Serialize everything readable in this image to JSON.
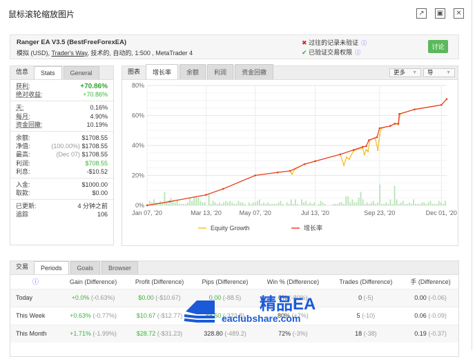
{
  "window": {
    "title": "鼠标滚轮缩放图片",
    "icons": [
      "external-link-icon",
      "maximize-icon",
      "close-icon"
    ]
  },
  "account": {
    "name": "Ranger EA V3.5 (BestFreeForexEA)",
    "desc_pre": "模拟 (USD), ",
    "broker": "Trader's Way",
    "desc_post": ", 技术的, 自动的, 1:500 , MetaTrader 4",
    "verify1": "过往的记录未验证",
    "verify2": "已验证交易权限",
    "discuss": "讨论"
  },
  "info": {
    "label": "信息",
    "tabs": [
      "Stats",
      "General"
    ],
    "groups": [
      [
        {
          "k": "获利:",
          "v": "+70.86%",
          "c": "gb"
        },
        {
          "k": "绝对收益:",
          "v": "+70.86%",
          "c": "g"
        }
      ],
      [
        {
          "k": "天:",
          "v": "0.16%"
        },
        {
          "k": "每月:",
          "v": "4.90%"
        },
        {
          "k": "资金回撤:",
          "v": "10.19%"
        }
      ],
      [
        {
          "k": "余额:",
          "v": "$1708.55"
        },
        {
          "k": "净值:",
          "pre": "(100.00%) ",
          "v": "$1708.55"
        },
        {
          "k": "最高:",
          "pre": "(Dec 07) ",
          "v": "$1708.55"
        },
        {
          "k": "利润:",
          "v": "$708.55",
          "c": "g"
        },
        {
          "k": "利息:",
          "v": "-$10.52"
        }
      ],
      [
        {
          "k": "入金:",
          "v": "$1000.00"
        },
        {
          "k": "取款:",
          "v": "$0.00"
        }
      ],
      [
        {
          "k": "已更新:",
          "v": "4 分钟之前"
        },
        {
          "k": "追踪",
          "v": "106"
        }
      ]
    ]
  },
  "chart_panel": {
    "label": "图表",
    "tabs": [
      "增长率",
      "余额",
      "利润",
      "资金回撤"
    ],
    "more": "更多",
    "export": "导"
  },
  "chart_data": {
    "type": "line",
    "ylim": [
      0,
      80
    ],
    "yticks": [
      "0%",
      "20%",
      "40%",
      "60%",
      "80%"
    ],
    "xticks": [
      "Jan 07, '20",
      "Mar 13, '20",
      "May 07, '20",
      "Jul 13, '20",
      "Sep 23, '20",
      "Dec 01, '20"
    ],
    "xrange": [
      "2020-01-07",
      "2020-12-07"
    ],
    "grid": true,
    "legend_placement": "bottom",
    "series": [
      {
        "name": "Equity Growth",
        "color": "#f5c02a",
        "points": [
          [
            "2020-01-07",
            0
          ],
          [
            "2020-02-01",
            2.5
          ],
          [
            "2020-03-13",
            7
          ],
          [
            "2020-04-01",
            11
          ],
          [
            "2020-05-07",
            20
          ],
          [
            "2020-06-01",
            22
          ],
          [
            "2020-06-15",
            23
          ],
          [
            "2020-06-17",
            21
          ],
          [
            "2020-06-20",
            24
          ],
          [
            "2020-07-01",
            27.5
          ],
          [
            "2020-07-13",
            29.5
          ],
          [
            "2020-08-10",
            34
          ],
          [
            "2020-08-14",
            27
          ],
          [
            "2020-08-17",
            32
          ],
          [
            "2020-08-20",
            31
          ],
          [
            "2020-08-25",
            36.5
          ],
          [
            "2020-09-04",
            38.5
          ],
          [
            "2020-09-06",
            34
          ],
          [
            "2020-09-08",
            37
          ],
          [
            "2020-09-10",
            36
          ],
          [
            "2020-09-12",
            43.5
          ],
          [
            "2020-09-18",
            45
          ],
          [
            "2020-09-21",
            37
          ],
          [
            "2020-09-23",
            47
          ],
          [
            "2020-09-25",
            51.5
          ],
          [
            "2020-10-05",
            53
          ],
          [
            "2020-10-10",
            54.5
          ],
          [
            "2020-10-14",
            54
          ],
          [
            "2020-10-16",
            61
          ],
          [
            "2020-11-01",
            64
          ],
          [
            "2020-12-01",
            67
          ],
          [
            "2020-12-07",
            70.9
          ]
        ]
      },
      {
        "name": "增长率",
        "color": "#e8412c",
        "points": [
          [
            "2020-01-07",
            0
          ],
          [
            "2020-02-01",
            2.5
          ],
          [
            "2020-03-13",
            7
          ],
          [
            "2020-04-01",
            11
          ],
          [
            "2020-05-07",
            20
          ],
          [
            "2020-06-01",
            22
          ],
          [
            "2020-06-15",
            23
          ],
          [
            "2020-07-01",
            27.5
          ],
          [
            "2020-07-13",
            29.5
          ],
          [
            "2020-08-10",
            34
          ],
          [
            "2020-08-25",
            37
          ],
          [
            "2020-09-04",
            39
          ],
          [
            "2020-09-08",
            39.5
          ],
          [
            "2020-09-11",
            43.5
          ],
          [
            "2020-09-20",
            45.5
          ],
          [
            "2020-09-23",
            51.5
          ],
          [
            "2020-10-05",
            53
          ],
          [
            "2020-10-10",
            54.5
          ],
          [
            "2020-10-14",
            54.5
          ],
          [
            "2020-10-15",
            61
          ],
          [
            "2020-11-01",
            64
          ],
          [
            "2020-12-01",
            67
          ],
          [
            "2020-12-07",
            70.9
          ]
        ]
      }
    ],
    "bars": {
      "color": "#b9e3b9",
      "values": [
        1,
        3,
        2,
        4,
        2,
        1,
        3,
        2,
        9,
        2,
        1,
        5,
        3,
        2,
        4,
        1,
        1,
        1,
        1,
        2,
        5,
        3,
        6,
        6,
        5,
        3,
        2,
        2,
        0,
        8,
        1,
        3,
        2,
        1,
        2,
        1,
        2,
        3,
        2,
        3,
        2,
        1,
        1,
        3,
        2,
        2,
        1,
        0,
        2,
        1,
        2,
        2,
        3,
        4,
        1,
        2,
        1,
        2,
        1,
        1,
        1,
        1,
        2,
        3,
        1,
        0,
        2,
        1,
        4,
        1,
        4,
        1,
        0,
        4,
        2,
        3,
        1,
        2,
        1,
        2,
        0,
        1,
        3,
        2,
        1,
        0,
        0,
        0,
        1,
        1,
        1,
        2,
        2,
        1,
        6,
        6,
        2,
        4,
        2,
        2,
        5,
        9,
        4,
        1,
        2,
        1,
        2,
        3,
        1,
        2,
        14,
        1,
        1,
        2,
        1,
        4,
        1,
        13,
        4,
        1,
        2,
        3,
        1,
        1,
        2,
        1,
        4,
        1,
        1,
        1,
        2,
        2,
        1,
        2,
        3,
        1,
        1,
        1,
        3,
        2,
        1,
        3
      ]
    }
  },
  "periods": {
    "label": "交易",
    "tabs": [
      "Periods",
      "Goals",
      "Browser"
    ],
    "headers": [
      "Gain (Difference)",
      "Profit (Difference)",
      "Pips (Difference)",
      "Win % (Difference)",
      "Trades (Difference)",
      "手 (Difference)"
    ],
    "rows": [
      {
        "name": "Today",
        "cells": [
          [
            "+0.0%",
            "(-0.63%)"
          ],
          [
            "$0.00",
            "(-$10.67)"
          ],
          [
            "0.00",
            "(-88.5)"
          ],
          [
            "0%",
            "(-80%)"
          ],
          [
            "0",
            "(-5)"
          ],
          [
            "0.00",
            "(-0.06)"
          ]
        ]
      },
      {
        "name": "This Week",
        "cells": [
          [
            "+0.63%",
            "(-0.77%)"
          ],
          [
            "$10.67",
            "(-$12.77)"
          ],
          [
            "88.50",
            "(-323.8)"
          ],
          [
            "80%",
            "(+7%)"
          ],
          [
            "5",
            "(-10)"
          ],
          [
            "0.06",
            "(-0.09)"
          ]
        ]
      },
      {
        "name": "This Month",
        "cells": [
          [
            "+1.71%",
            "(-1.99%)"
          ],
          [
            "$28.72",
            "(-$31.23)"
          ],
          [
            "328.80",
            "(-489.2)"
          ],
          [
            "72%",
            "(-3%)"
          ],
          [
            "18",
            "(-38)"
          ],
          [
            "0.19",
            "(-0.37)"
          ]
        ]
      }
    ],
    "green_cols": [
      [
        0,
        1,
        1,
        1
      ],
      [
        0,
        1,
        1,
        1
      ],
      [
        0,
        1,
        1,
        0
      ],
      [
        0,
        0,
        0,
        0
      ],
      [
        0,
        0,
        0,
        0
      ],
      [
        0,
        0,
        0,
        0
      ]
    ]
  },
  "watermark": {
    "big": "精品EA",
    "small": "eaclubshare.com"
  }
}
